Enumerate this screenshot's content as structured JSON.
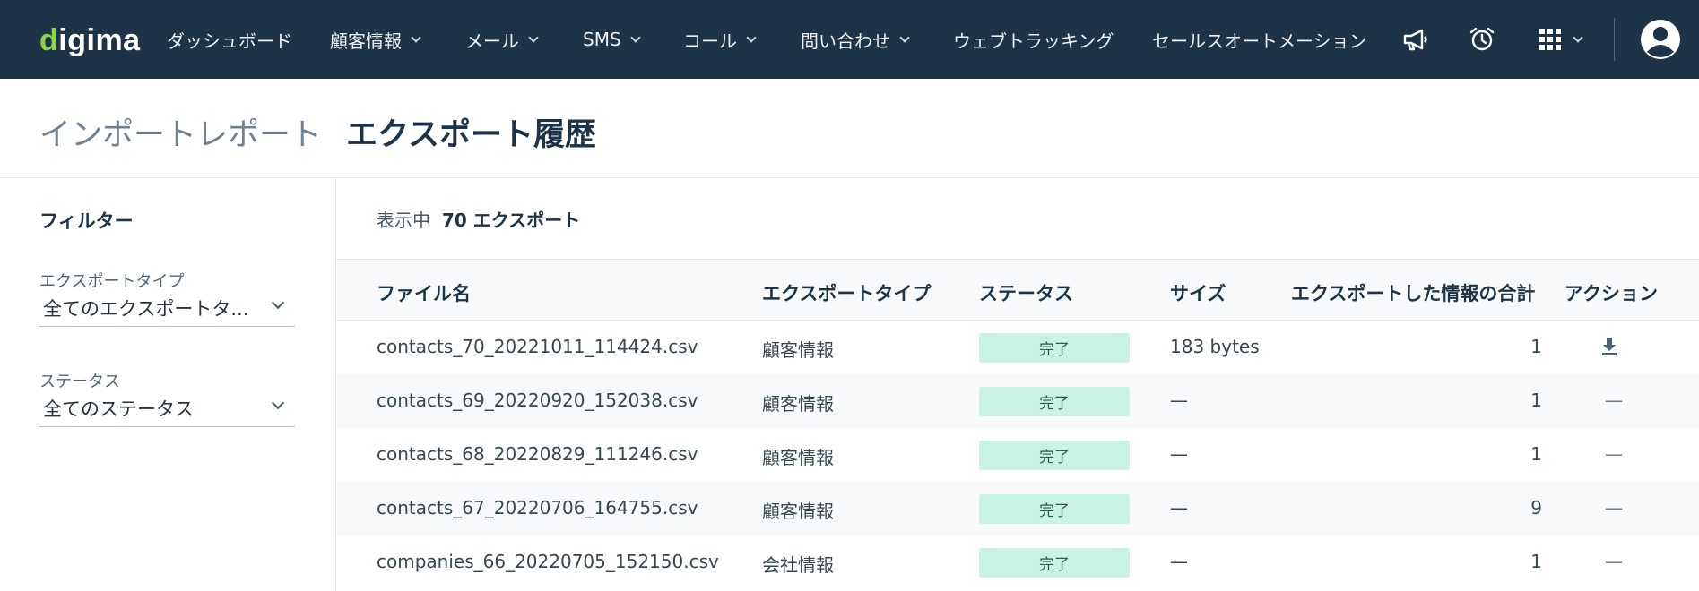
{
  "nav": {
    "logo": {
      "d": "d",
      "rest": "igima"
    },
    "items": [
      {
        "label": "ダッシュボード",
        "has_dropdown": false
      },
      {
        "label": "顧客情報",
        "has_dropdown": true
      },
      {
        "label": "メール",
        "has_dropdown": true
      },
      {
        "label": "SMS",
        "has_dropdown": true
      },
      {
        "label": "コール",
        "has_dropdown": true
      },
      {
        "label": "問い合わせ",
        "has_dropdown": true
      },
      {
        "label": "ウェブトラッキング",
        "has_dropdown": false
      },
      {
        "label": "セールスオートメーション",
        "has_dropdown": false
      }
    ],
    "icons": [
      "megaphone-icon",
      "alarm-clock-icon",
      "apps-grid-icon",
      "user-avatar-icon"
    ]
  },
  "header": {
    "tabs": [
      {
        "label": "インポートレポート",
        "active": false
      },
      {
        "label": "エクスポート履歴",
        "active": true
      }
    ]
  },
  "sidebar": {
    "title": "フィルター",
    "filters": [
      {
        "label": "エクスポートタイプ",
        "value": "全てのエクスポートタ..."
      },
      {
        "label": "ステータス",
        "value": "全てのステータス"
      }
    ]
  },
  "summary": {
    "prefix": "表示中",
    "count_text": "70 エクスポート"
  },
  "table": {
    "columns": [
      "ファイル名",
      "エクスポートタイプ",
      "ステータス",
      "サイズ",
      "エクスポートした情報の合計",
      "アクション"
    ],
    "rows": [
      {
        "file": "contacts_70_20221011_114424.csv",
        "type": "顧客情報",
        "status": "完了",
        "size": "183 bytes",
        "total": "1",
        "action": "download-icon"
      },
      {
        "file": "contacts_69_20220920_152038.csv",
        "type": "顧客情報",
        "status": "完了",
        "size": "—",
        "total": "1",
        "action": "—"
      },
      {
        "file": "contacts_68_20220829_111246.csv",
        "type": "顧客情報",
        "status": "完了",
        "size": "—",
        "total": "1",
        "action": "—"
      },
      {
        "file": "contacts_67_20220706_164755.csv",
        "type": "顧客情報",
        "status": "完了",
        "size": "—",
        "total": "9",
        "action": "—"
      },
      {
        "file": "companies_66_20220705_152150.csv",
        "type": "会社情報",
        "status": "完了",
        "size": "—",
        "total": "1",
        "action": "—"
      }
    ]
  },
  "colors": {
    "nav_bg": "#1d3347",
    "logo_accent": "#8bd546",
    "badge_bg": "#c9f3e3",
    "badge_text": "#2e5c4a"
  }
}
